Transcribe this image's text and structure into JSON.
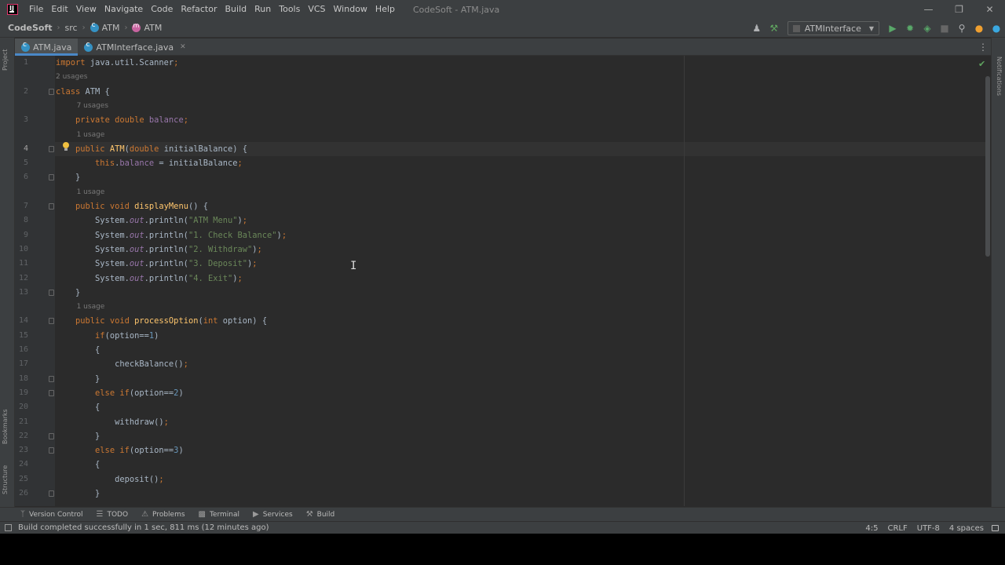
{
  "menu": {
    "items": [
      "File",
      "Edit",
      "View",
      "Navigate",
      "Code",
      "Refactor",
      "Build",
      "Run",
      "Tools",
      "VCS",
      "Window",
      "Help"
    ],
    "window_title": "CodeSoft - ATM.java"
  },
  "breadcrumb": {
    "project": "CodeSoft",
    "folder": "src",
    "file_class": "ATM",
    "member": "ATM"
  },
  "run_config": {
    "label": "ATMInterface"
  },
  "tabs": [
    {
      "label": "ATM.java",
      "active": true
    },
    {
      "label": "ATMInterface.java",
      "active": false
    }
  ],
  "side_panels": {
    "project": "Project",
    "bookmarks": "Bookmarks",
    "structure": "Structure",
    "notifications": "Notifications"
  },
  "editor": {
    "current_line": 4,
    "rows": [
      {
        "n": "1",
        "t": "import java.util.Scanner;"
      },
      {
        "hint": "2 usages",
        "indent": 0
      },
      {
        "n": "2",
        "t": "class ATM {"
      },
      {
        "hint": "7 usages",
        "indent": 1
      },
      {
        "n": "3",
        "t": "    private double balance;"
      },
      {
        "hint": "1 usage",
        "indent": 1
      },
      {
        "n": "4",
        "t": "    public ATM(double initialBalance) {"
      },
      {
        "n": "5",
        "t": "        this.balance = initialBalance;"
      },
      {
        "n": "6",
        "t": "    }"
      },
      {
        "hint": "1 usage",
        "indent": 1
      },
      {
        "n": "7",
        "t": "    public void displayMenu() {"
      },
      {
        "n": "8",
        "t": "        System.out.println(\"ATM Menu\");"
      },
      {
        "n": "9",
        "t": "        System.out.println(\"1. Check Balance\");"
      },
      {
        "n": "10",
        "t": "        System.out.println(\"2. Withdraw\");"
      },
      {
        "n": "11",
        "t": "        System.out.println(\"3. Deposit\");"
      },
      {
        "n": "12",
        "t": "        System.out.println(\"4. Exit\");"
      },
      {
        "n": "13",
        "t": "    }"
      },
      {
        "hint": "1 usage",
        "indent": 1
      },
      {
        "n": "14",
        "t": "    public void processOption(int option) {"
      },
      {
        "n": "15",
        "t": "        if(option==1)"
      },
      {
        "n": "16",
        "t": "        {"
      },
      {
        "n": "17",
        "t": "            checkBalance();"
      },
      {
        "n": "18",
        "t": "        }"
      },
      {
        "n": "19",
        "t": "        else if(option==2)"
      },
      {
        "n": "20",
        "t": "        {"
      },
      {
        "n": "21",
        "t": "            withdraw();"
      },
      {
        "n": "22",
        "t": "        }"
      },
      {
        "n": "23",
        "t": "        else if(option==3)"
      },
      {
        "n": "24",
        "t": "        {"
      },
      {
        "n": "25",
        "t": "            deposit();"
      },
      {
        "n": "26",
        "t": "        }"
      }
    ]
  },
  "bottom_tools": [
    {
      "label": "Version Control",
      "icon": "branch-icon"
    },
    {
      "label": "TODO",
      "icon": "list-icon"
    },
    {
      "label": "Problems",
      "icon": "warning-icon"
    },
    {
      "label": "Terminal",
      "icon": "terminal-icon"
    },
    {
      "label": "Services",
      "icon": "services-icon"
    },
    {
      "label": "Build",
      "icon": "hammer-icon"
    }
  ],
  "status": {
    "message": "Build completed successfully in 1 sec, 811 ms (12 minutes ago)",
    "position": "4:5",
    "line_separator": "CRLF",
    "encoding": "UTF-8",
    "indent": "4 spaces"
  },
  "colors": {
    "keyword": "#cc7832",
    "method": "#ffc66d",
    "field": "#9876aa",
    "string": "#6a8759",
    "number": "#6897bb",
    "text": "#a9b7c6",
    "background": "#2b2b2b"
  }
}
